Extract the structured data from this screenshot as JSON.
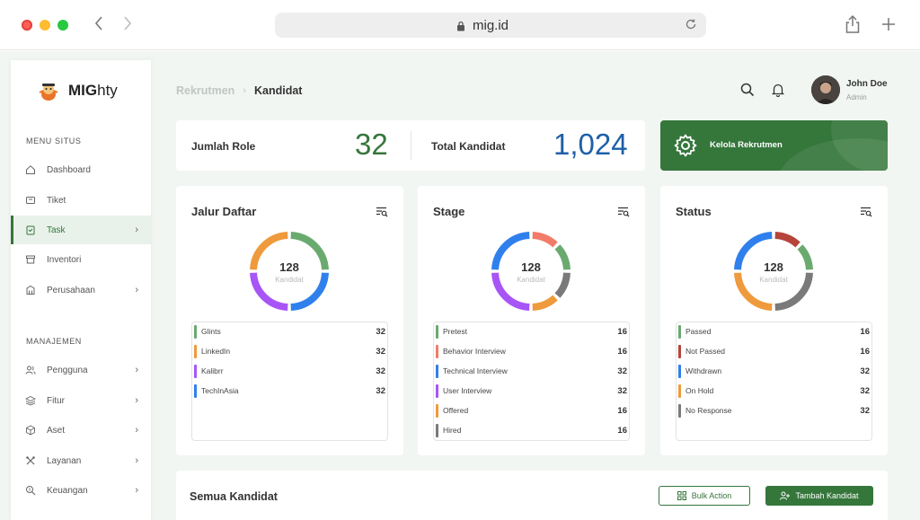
{
  "browser": {
    "url": "mig.id"
  },
  "brand": {
    "name_bold": "MIG",
    "name_rest": "hty"
  },
  "sidebar": {
    "section_menu": "MENU SITUS",
    "section_manage": "MANAJEMEN",
    "menu_items": [
      {
        "label": "Dashboard",
        "icon": "home-icon",
        "has_chevron": false,
        "active": false
      },
      {
        "label": "Tiket",
        "icon": "ticket-icon",
        "has_chevron": false,
        "active": false
      },
      {
        "label": "Task",
        "icon": "clipboard-icon",
        "has_chevron": true,
        "active": true
      },
      {
        "label": "Inventori",
        "icon": "archive-icon",
        "has_chevron": false,
        "active": false
      },
      {
        "label": "Perusahaan",
        "icon": "building-icon",
        "has_chevron": true,
        "active": false
      }
    ],
    "manage_items": [
      {
        "label": "Pengguna",
        "icon": "users-icon",
        "has_chevron": true
      },
      {
        "label": "Fitur",
        "icon": "layers-icon",
        "has_chevron": true
      },
      {
        "label": "Aset",
        "icon": "box-icon",
        "has_chevron": true
      },
      {
        "label": "Layanan",
        "icon": "tools-icon",
        "has_chevron": true
      },
      {
        "label": "Keuangan",
        "icon": "money-search-icon",
        "has_chevron": true
      }
    ]
  },
  "header": {
    "breadcrumb_parent": "Rekrutmen",
    "breadcrumb_separator": "›",
    "breadcrumb_current": "Kandidat",
    "user_name": "John Doe",
    "user_role": "Admin"
  },
  "stats": {
    "role_label": "Jumlah Role",
    "role_value": "32",
    "kandidat_label": "Total Kandidat",
    "kandidat_value": "1,024",
    "role_color": "#35763B",
    "kandidat_color": "#1F5FA8"
  },
  "kelola": {
    "label": "Kelola Rekrutmen",
    "bg_color": "#35763B"
  },
  "charts": [
    {
      "title": "Jalur Daftar",
      "total": "128",
      "total_label": "Kandidat",
      "items": [
        {
          "name": "Glints",
          "value": 32,
          "color": "#6AAA6F"
        },
        {
          "name": "LinkedIn",
          "value": 32,
          "color": "#EF9A3C"
        },
        {
          "name": "Kalibrr",
          "value": 32,
          "color": "#A855F7"
        },
        {
          "name": "TechInAsia",
          "value": 32,
          "color": "#2F80ED"
        }
      ]
    },
    {
      "title": "Stage",
      "total": "128",
      "total_label": "Kandidat",
      "items": [
        {
          "name": "Pretest",
          "value": 16,
          "color": "#6AAA6F"
        },
        {
          "name": "Behavior Interview",
          "value": 16,
          "color": "#F27C6A"
        },
        {
          "name": "Technical Interview",
          "value": 32,
          "color": "#2F80ED"
        },
        {
          "name": "User Interview",
          "value": 32,
          "color": "#A855F7"
        },
        {
          "name": "Offered",
          "value": 16,
          "color": "#EF9A3C"
        },
        {
          "name": "Hired",
          "value": 16,
          "color": "#7A7A7A"
        }
      ]
    },
    {
      "title": "Status",
      "total": "128",
      "total_label": "Kandidat",
      "items": [
        {
          "name": "Passed",
          "value": 16,
          "color": "#6AAA6F"
        },
        {
          "name": "Not Passed",
          "value": 16,
          "color": "#B5443A"
        },
        {
          "name": "Withdrawn",
          "value": 32,
          "color": "#2F80ED"
        },
        {
          "name": "On Hold",
          "value": 32,
          "color": "#EF9A3C"
        },
        {
          "name": "No Response",
          "value": 32,
          "color": "#7A7A7A"
        }
      ]
    }
  ],
  "chart_donut_order": [
    [
      "#6AAA6F",
      "#2F80ED",
      "#A855F7",
      "#EF9A3C"
    ],
    [
      "#F27C6A",
      "#6AAA6F",
      "#7A7A7A",
      "#EF9A3C",
      "#A855F7",
      "#2F80ED"
    ],
    [
      "#B5443A",
      "#6AAA6F",
      "#7A7A7A",
      "#EF9A3C",
      "#2F80ED"
    ]
  ],
  "candidates": {
    "title": "Semua Kandidat",
    "bulk_label": "Bulk Action",
    "add_label": "Tambah Kandidat"
  }
}
